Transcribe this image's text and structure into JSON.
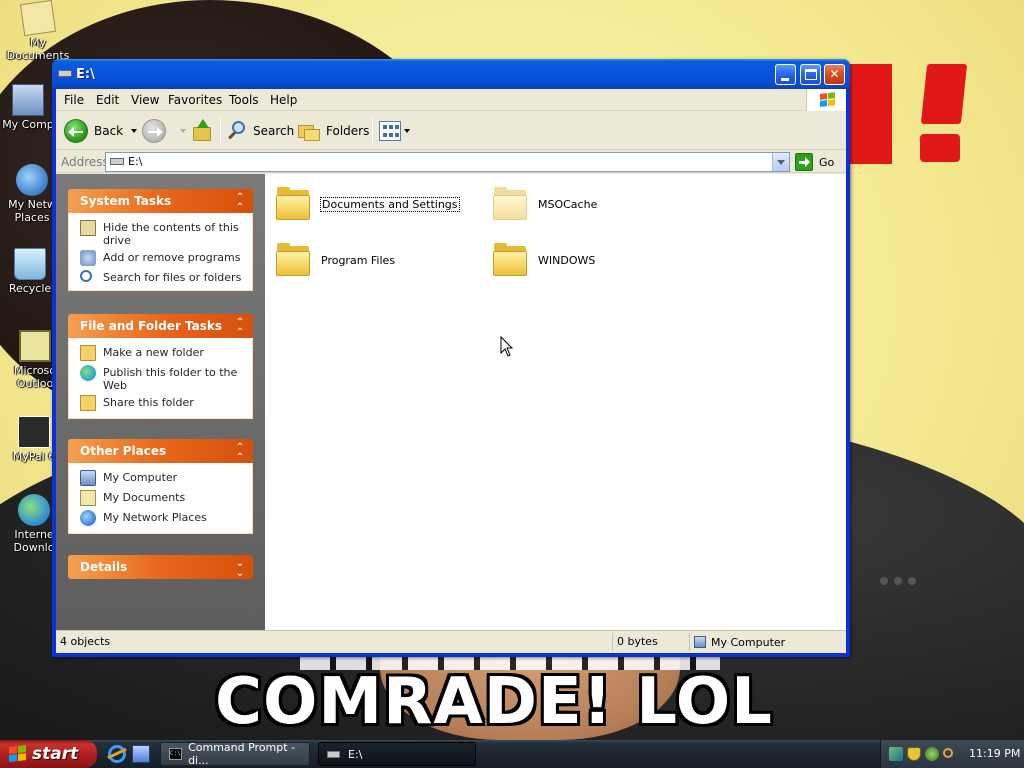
{
  "desktop": {
    "icons": [
      {
        "label": "My Documents"
      },
      {
        "label": "My Comp"
      },
      {
        "label": "My Netw"
      },
      {
        "label": "Places"
      },
      {
        "label": "Recycle"
      },
      {
        "label": "Microso"
      },
      {
        "label": "Outloo"
      },
      {
        "label": "MyPal 6"
      },
      {
        "label": "Interne"
      },
      {
        "label": "Downlo"
      }
    ],
    "wallpaper_caption": "COMRADE! LOL",
    "wallpaper_color": "#f3ea9a"
  },
  "window": {
    "title": "E:\\",
    "menu": [
      "File",
      "Edit",
      "View",
      "Favorites",
      "Tools",
      "Help"
    ],
    "toolbar": {
      "back_label": "Back",
      "search_label": "Search",
      "folders_label": "Folders"
    },
    "address": {
      "label": "Address",
      "value": "E:\\",
      "go_label": "Go"
    },
    "task_panels": [
      {
        "title": "System Tasks",
        "items": [
          {
            "label": "Hide the contents of this drive",
            "icon": "hide-contents-icon"
          },
          {
            "label": "Add or remove programs",
            "icon": "add-remove-programs-icon"
          },
          {
            "label": "Search for files or folders",
            "icon": "search-icon"
          }
        ]
      },
      {
        "title": "File and Folder Tasks",
        "items": [
          {
            "label": "Make a new folder",
            "icon": "new-folder-icon"
          },
          {
            "label": "Publish this folder to the Web",
            "icon": "publish-web-icon"
          },
          {
            "label": "Share this folder",
            "icon": "share-folder-icon"
          }
        ]
      },
      {
        "title": "Other Places",
        "items": [
          {
            "label": "My Computer",
            "icon": "my-computer-icon"
          },
          {
            "label": "My Documents",
            "icon": "my-documents-icon"
          },
          {
            "label": "My Network Places",
            "icon": "network-places-icon"
          }
        ]
      },
      {
        "title": "Details",
        "items": []
      }
    ],
    "files": [
      {
        "name": "Documents and Settings",
        "hidden": false,
        "focused": true
      },
      {
        "name": "MSOCache",
        "hidden": true,
        "focused": false
      },
      {
        "name": "Program Files",
        "hidden": false,
        "focused": false
      },
      {
        "name": "WINDOWS",
        "hidden": false,
        "focused": false
      }
    ],
    "status": {
      "objects": "4 objects",
      "size": "0 bytes",
      "zone": "My Computer"
    },
    "accent_color": "#0054e3",
    "task_header_color": "#e8671b"
  },
  "taskbar": {
    "start_label": "start",
    "tasks": [
      {
        "label": "Command Prompt - di..."
      },
      {
        "label": "E:\\"
      }
    ],
    "clock": "11:19 PM"
  }
}
